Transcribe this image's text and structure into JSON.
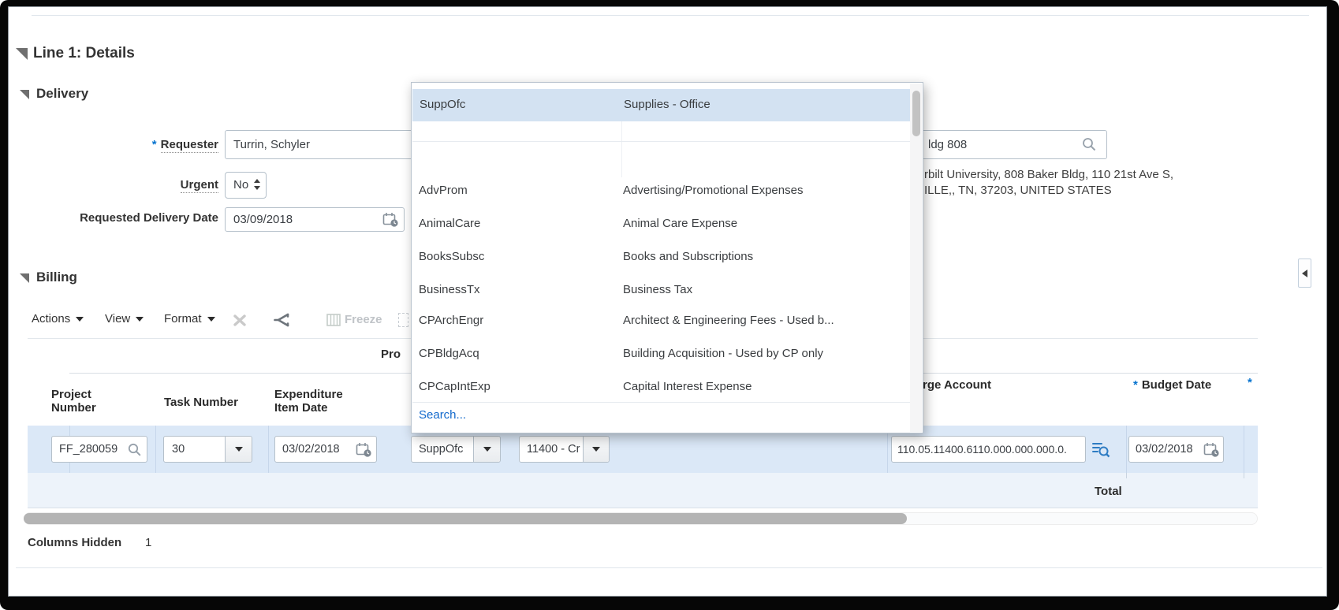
{
  "line1": {
    "title": "Line 1: Details"
  },
  "delivery": {
    "title": "Delivery",
    "required_marker": "*",
    "requester_label": "Requester",
    "requester_value": "Turrin, Schyler",
    "urgent_label": "Urgent",
    "urgent_value": "No",
    "requested_delivery_date_label": "Requested Delivery Date",
    "requested_delivery_date_value": "03/09/2018",
    "deliver_to_location_value": "ldg 808",
    "address_line_1": "rbilt University, 808 Baker Bldg, 110 21st Ave S,",
    "address_line_2": "ILLE,, TN, 37203, UNITED STATES"
  },
  "expenditure_type_dropdown": {
    "selected_item": {
      "code": "SuppOfc",
      "description": "Supplies - Office"
    },
    "items": [
      {
        "code": "AdvProm",
        "description": "Advertising/Promotional Expenses"
      },
      {
        "code": "AnimalCare",
        "description": "Animal Care Expense"
      },
      {
        "code": "BooksSubsc",
        "description": "Books and Subscriptions"
      },
      {
        "code": "BusinessTx",
        "description": "Business Tax"
      },
      {
        "code": "CPArchEngr",
        "description": "Architect & Engineering Fees - Used b..."
      },
      {
        "code": "CPBldgAcq",
        "description": "Building Acquisition - Used by CP only"
      },
      {
        "code": "CPCapIntExp",
        "description": "Capital Interest Expense"
      }
    ],
    "search_link": "Search..."
  },
  "billing": {
    "title": "Billing",
    "toolbar": {
      "actions": "Actions",
      "view": "View",
      "format": "Format",
      "freeze": "Freeze"
    },
    "group_header_partial": "Pro",
    "columns": {
      "required_marker": "*",
      "project_number": "Project\nNumber",
      "task_number": "Task Number",
      "expenditure_item_date": "Expenditure\nItem Date",
      "charge_account_partial": "rge Account",
      "budget_date": "Budget Date"
    },
    "row": {
      "project_number": "FF_280059",
      "task_number": "30",
      "expenditure_item_date": "03/02/2018",
      "expenditure_type": "SuppOfc",
      "account": "11400 - Cr",
      "charge_account": "110.05.11400.6110.000.000.000.0.",
      "budget_date": "03/02/2018"
    },
    "total_label": "Total",
    "columns_hidden_label": "Columns Hidden",
    "columns_hidden_value": "1"
  },
  "colors": {
    "selected_row": "#dbe8f7",
    "total_row": "#edf3fa",
    "dropdown_highlight": "#d3e2f2",
    "link_blue": "#1269cc",
    "required_blue": "#0572ce",
    "flexfield_icon_blue": "#2e7cc3"
  }
}
